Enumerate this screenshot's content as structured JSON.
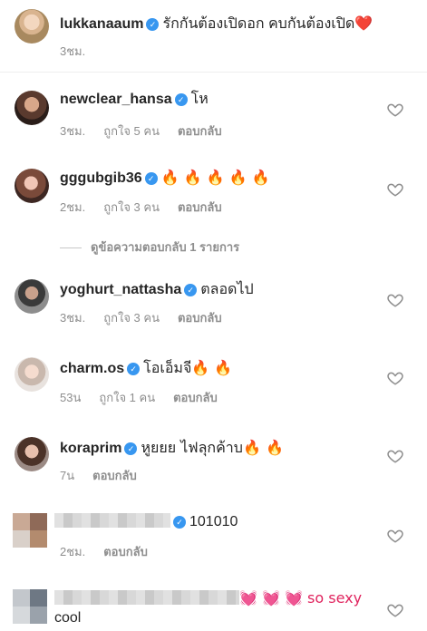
{
  "caption": {
    "username": "lukkanaaum",
    "text": "รักกันต้องเปิดอก คบกันต้องเปิด",
    "emoji": "❤️",
    "time": "3ชม."
  },
  "comments": [
    {
      "username": "newclear_hansa",
      "verified": true,
      "text": "โห",
      "time": "3ชม.",
      "likes": "ถูกใจ 5 คน",
      "reply": "ตอบกลับ"
    },
    {
      "username": "gggubgib36",
      "verified": true,
      "text": "🔥 🔥 🔥 🔥 🔥",
      "time": "2ชม.",
      "likes": "ถูกใจ 3 คน",
      "reply": "ตอบกลับ"
    },
    {
      "username": "yoghurt_nattasha",
      "verified": true,
      "text": "ตลอดไป",
      "time": "3ชม.",
      "likes": "ถูกใจ 3 คน",
      "reply": "ตอบกลับ"
    },
    {
      "username": "charm.os",
      "verified": true,
      "text": "โอเอ็มจี🔥 🔥",
      "time": "53น",
      "likes": "ถูกใจ 1 คน",
      "reply": "ตอบกลับ"
    },
    {
      "username": "koraprim",
      "verified": true,
      "text": "หูยยย ไฟลุกค้าบ🔥 🔥",
      "time": "7น",
      "reply": "ตอบกลับ"
    },
    {
      "verified": true,
      "text": "101010",
      "time": "2ชม.",
      "reply": "ตอบกลับ"
    },
    {
      "text": "💓 💓 💓 so sexy",
      "text2": "cool"
    }
  ],
  "view_replies": "ดูข้อความตอบกลับ 1 รายการ",
  "colors": {
    "verified": "#3897f0",
    "muted": "#8e8e8e",
    "text": "#262626"
  }
}
